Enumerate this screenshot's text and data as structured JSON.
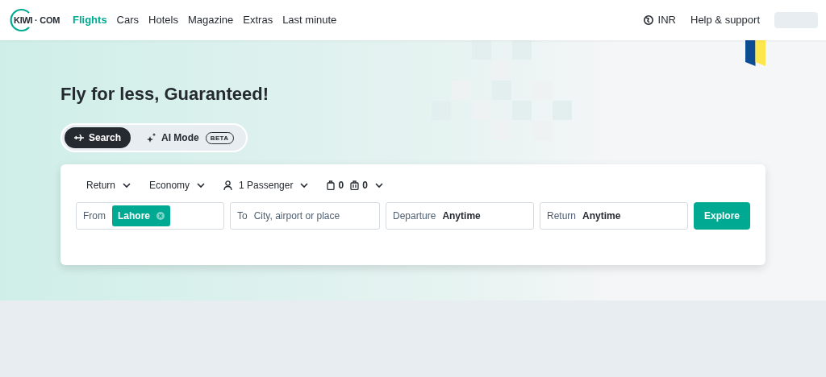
{
  "header": {
    "logo": "KIWI · COM",
    "nav": [
      {
        "label": "Flights",
        "selected": true
      },
      {
        "label": "Cars",
        "selected": false
      },
      {
        "label": "Hotels",
        "selected": false
      },
      {
        "label": "Magazine",
        "selected": false
      },
      {
        "label": "Extras",
        "selected": false
      },
      {
        "label": "Last minute",
        "selected": false
      }
    ],
    "currency": "INR",
    "help": "Help & support"
  },
  "hero": {
    "title": "Fly for less, Guaranteed!",
    "modes": [
      {
        "label": "Search",
        "selected": true,
        "kind": "search"
      },
      {
        "label": "AI Mode",
        "badge": "BETA",
        "selected": false,
        "kind": "ai"
      }
    ]
  },
  "search": {
    "options": [
      {
        "kind": "trip",
        "label": "Return"
      },
      {
        "kind": "cabin",
        "label": "Economy"
      },
      {
        "kind": "passengers",
        "label": "1 Passenger"
      }
    ],
    "bags": [
      {
        "kind": "cabin",
        "count": "0"
      },
      {
        "kind": "checked",
        "count": "0"
      }
    ],
    "fields": [
      {
        "kind": "chip",
        "label": "From",
        "value": "Lahore"
      },
      {
        "kind": "placeholder",
        "label": "To",
        "placeholder": "City, airport or place"
      },
      {
        "kind": "value",
        "label": "Departure",
        "value": "Anytime"
      },
      {
        "kind": "value",
        "label": "Return",
        "value": "Anytime"
      }
    ],
    "button": "Explore"
  }
}
